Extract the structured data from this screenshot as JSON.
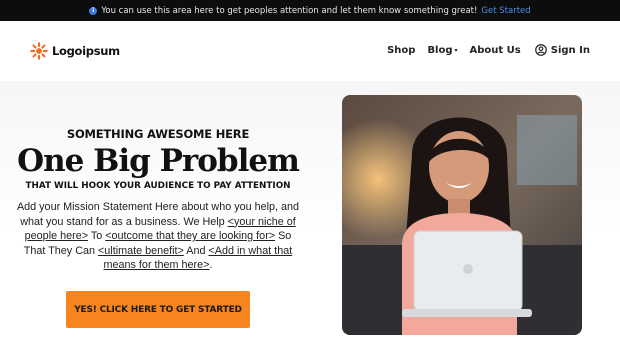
{
  "announcement": {
    "text": "You can use this area here to get peoples attention and let them know something great!",
    "link": "Get Started"
  },
  "header": {
    "logo_text": "Logoipsum",
    "nav": [
      {
        "label": "Shop"
      },
      {
        "label": "Blog"
      },
      {
        "label": "About Us"
      }
    ],
    "sign_in": "Sign In"
  },
  "hero": {
    "eyebrow": "SOMETHING AWESOME HERE",
    "headline": "One Big Problem",
    "subhead": "THAT WILL HOOK YOUR AUDIENCE TO PAY ATTENTION",
    "mission": {
      "p1": "Add your Mission Statement Here about who you help, and what you stand for as a business. We Help ",
      "u1": "<your niche of people here>",
      "p2": " To ",
      "u2": "<outcome that they are looking for>",
      "p3": " So That They Can ",
      "u3": "<ultimate benefit>",
      "p4": " And ",
      "u4": "<Add in what that means for them here>",
      "p5": "."
    },
    "cta": "YES! CLICK HERE TO GET STARTED"
  },
  "colors": {
    "accent": "#f6851f",
    "announcement_bg": "#0d0d0d",
    "link": "#4d8fe6"
  }
}
